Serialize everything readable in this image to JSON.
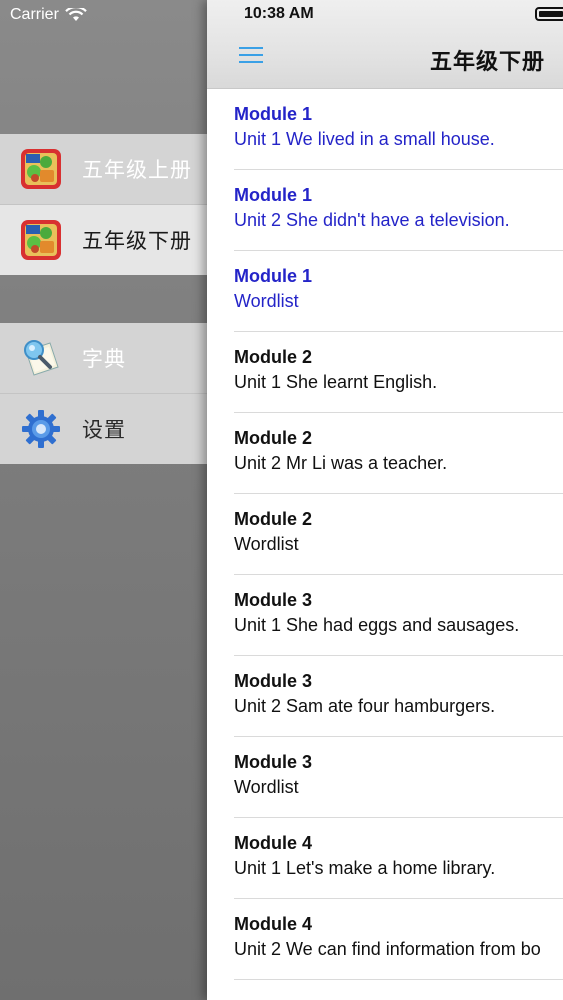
{
  "status_bar": {
    "carrier": "Carrier",
    "time": "10:38 AM"
  },
  "drawer": {
    "books": [
      {
        "label": "五年级上册",
        "icon": "book-cover-icon",
        "selected": false
      },
      {
        "label": "五年级下册",
        "icon": "book-cover-icon",
        "selected": true
      }
    ],
    "tools": [
      {
        "label": "字典",
        "icon": "dictionary-icon"
      },
      {
        "label": "设置",
        "icon": "gear-icon"
      }
    ]
  },
  "navbar": {
    "title": "五年级下册",
    "menu_icon": "hamburger-menu-icon"
  },
  "colors": {
    "visited_link": "#2424c8",
    "menu_accent": "#3aa0e6"
  },
  "lessons": [
    {
      "module": "Module 1",
      "unit": "Unit 1 We lived in a small house.",
      "visited": true
    },
    {
      "module": "Module 1",
      "unit": "Unit 2 She didn't have a television.",
      "visited": true
    },
    {
      "module": "Module 1",
      "unit": "Wordlist",
      "visited": true
    },
    {
      "module": "Module 2",
      "unit": "Unit 1 She learnt English.",
      "visited": false
    },
    {
      "module": "Module 2",
      "unit": "Unit 2 Mr Li was a teacher.",
      "visited": false
    },
    {
      "module": "Module 2",
      "unit": "Wordlist",
      "visited": false
    },
    {
      "module": "Module 3",
      "unit": "Unit 1 She had eggs and sausages.",
      "visited": false
    },
    {
      "module": "Module 3",
      "unit": "Unit 2 Sam ate four hamburgers.",
      "visited": false
    },
    {
      "module": "Module 3",
      "unit": "Wordlist",
      "visited": false
    },
    {
      "module": "Module 4",
      "unit": "Unit 1 Let's make a home library.",
      "visited": false
    },
    {
      "module": "Module 4",
      "unit": "Unit 2 We can find information from bo",
      "visited": false
    }
  ]
}
